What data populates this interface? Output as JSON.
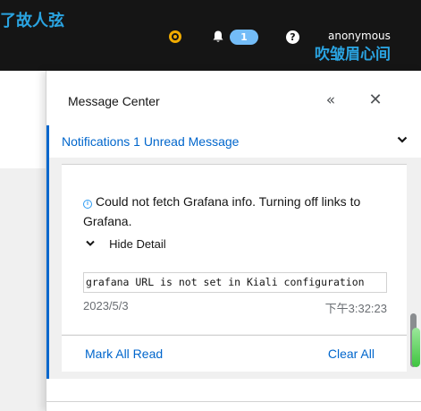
{
  "topbar": {
    "left_overlay_text": "了故人弦",
    "status_icon": "status-warning-dot",
    "notification_count": "1",
    "help_symbol": "?",
    "user_name": "anonymous",
    "right_overlay_text": "吹皱眉心间"
  },
  "drawer": {
    "title": "Message Center",
    "collapse_symbol": "«",
    "close_symbol": "✕"
  },
  "group": {
    "title": "Notifications 1 Unread Message",
    "message": {
      "text": "Could not fetch Grafana info. Turning off links to Grafana.",
      "detail_toggle_label": "Hide Detail",
      "detail": "grafana URL is not set in Kiali configuration",
      "date": "2023/5/3",
      "time": "下午3:32:23"
    },
    "footer": {
      "mark_all_label": "Mark All Read",
      "clear_all_label": "Clear All"
    }
  },
  "colors": {
    "topbar_bg": "#151515",
    "link_blue": "#0066cc",
    "accent_border": "#0066cc",
    "badge_bg": "#73bcf7",
    "warning": "#f0ab00",
    "overlay_text": "#2aa3e0"
  }
}
